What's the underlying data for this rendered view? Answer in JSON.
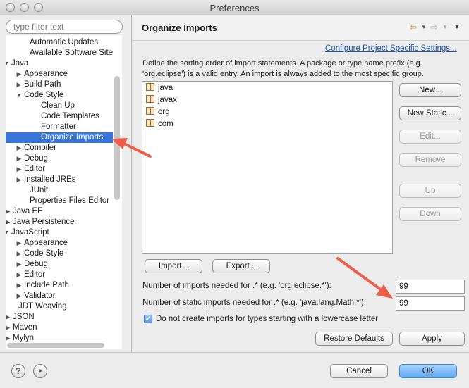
{
  "window": {
    "title": "Preferences"
  },
  "search": {
    "placeholder": "type filter text"
  },
  "tree": {
    "items": [
      {
        "label": "Automatic Updates",
        "twisty": ""
      },
      {
        "label": "Available Software Sites",
        "twisty": ""
      },
      {
        "label": "Java",
        "twisty": "expanded"
      },
      {
        "label": "Appearance",
        "twisty": "collapsed"
      },
      {
        "label": "Build Path",
        "twisty": "collapsed"
      },
      {
        "label": "Code Style",
        "twisty": "expanded"
      },
      {
        "label": "Clean Up",
        "twisty": ""
      },
      {
        "label": "Code Templates",
        "twisty": ""
      },
      {
        "label": "Formatter",
        "twisty": ""
      },
      {
        "label": "Organize Imports",
        "twisty": "",
        "selected": true
      },
      {
        "label": "Compiler",
        "twisty": "collapsed"
      },
      {
        "label": "Debug",
        "twisty": "collapsed"
      },
      {
        "label": "Editor",
        "twisty": "collapsed"
      },
      {
        "label": "Installed JREs",
        "twisty": "collapsed"
      },
      {
        "label": "JUnit",
        "twisty": ""
      },
      {
        "label": "Properties Files Editor",
        "twisty": ""
      },
      {
        "label": "Java EE",
        "twisty": "collapsed"
      },
      {
        "label": "Java Persistence",
        "twisty": "collapsed"
      },
      {
        "label": "JavaScript",
        "twisty": "expanded"
      },
      {
        "label": "Appearance",
        "twisty": "collapsed"
      },
      {
        "label": "Code Style",
        "twisty": "collapsed"
      },
      {
        "label": "Debug",
        "twisty": "collapsed"
      },
      {
        "label": "Editor",
        "twisty": "collapsed"
      },
      {
        "label": "Include Path",
        "twisty": "collapsed"
      },
      {
        "label": "Validator",
        "twisty": "collapsed"
      },
      {
        "label": "JDT Weaving",
        "twisty": ""
      },
      {
        "label": "JSON",
        "twisty": "collapsed"
      },
      {
        "label": "Maven",
        "twisty": "collapsed"
      },
      {
        "label": "Mylyn",
        "twisty": "collapsed"
      }
    ]
  },
  "page": {
    "title": "Organize Imports",
    "configure_link": "Configure Project Specific Settings...",
    "description": "Define the sorting order of import statements. A package or type name prefix (e.g. 'org.eclipse') is a valid entry. An import is always added to the most specific group.",
    "packages": [
      "java",
      "javax",
      "org",
      "com"
    ],
    "buttons": {
      "new": "New...",
      "new_static": "New Static...",
      "edit": "Edit...",
      "remove": "Remove",
      "up": "Up",
      "down": "Down",
      "import": "Import...",
      "export": "Export...",
      "restore_defaults": "Restore Defaults",
      "apply": "Apply"
    },
    "imports_label": "Number of imports needed for .* (e.g. 'org.eclipse.*'):",
    "imports_value": "99",
    "static_imports_label": "Number of static imports needed for .* (e.g. 'java.lang.Math.*'):",
    "static_imports_value": "99",
    "lowercase_checkbox_label": "Do not create imports for types starting with a lowercase letter",
    "lowercase_checked": true
  },
  "footer": {
    "help_symbol": "?",
    "cancel": "Cancel",
    "ok": "OK"
  },
  "colors": {
    "selection": "#3875d7",
    "link": "#1a53b0",
    "annotation_arrow": "#ee5d4a",
    "ok_button": "#5ea9f4"
  },
  "icons": {
    "tree_expanded": "▼",
    "tree_collapsed": "▶",
    "back": "back-arrow-icon",
    "forward": "forward-arrow-icon",
    "view_menu": "view-menu-icon",
    "package": "package-icon",
    "help": "help-icon",
    "import_prefs": "import-preferences-icon"
  }
}
